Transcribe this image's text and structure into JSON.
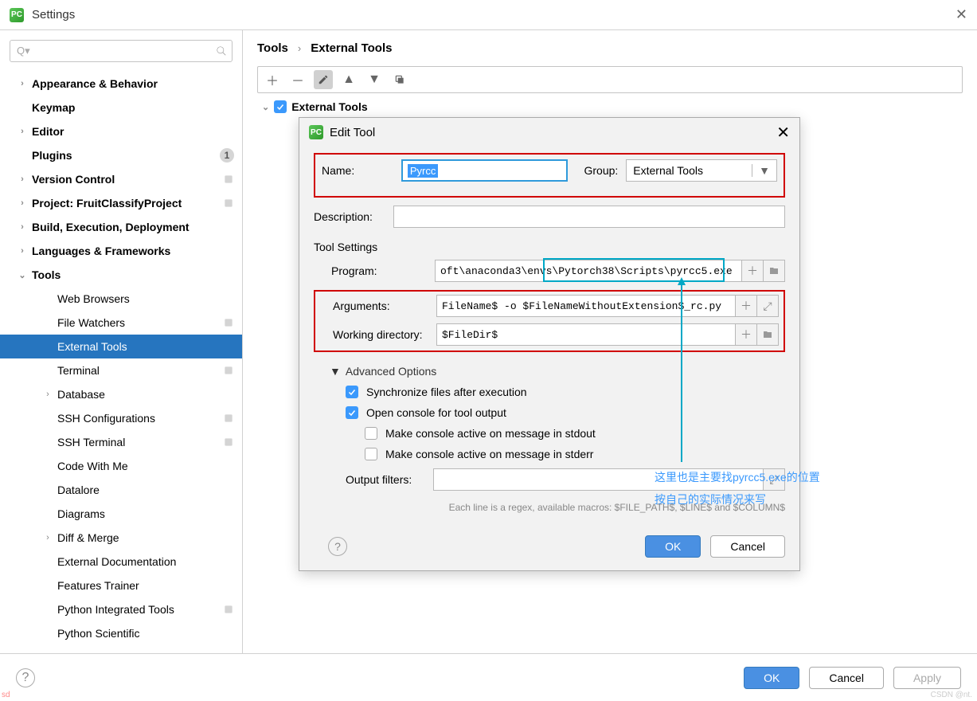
{
  "window": {
    "title": "Settings"
  },
  "search": {
    "placeholder": ""
  },
  "sidebar": [
    {
      "label": "Appearance & Behavior",
      "level": 1,
      "bold": true,
      "chev": "›"
    },
    {
      "label": "Keymap",
      "level": 1,
      "bold": true,
      "chev": ""
    },
    {
      "label": "Editor",
      "level": 1,
      "bold": true,
      "chev": "›"
    },
    {
      "label": "Plugins",
      "level": 1,
      "bold": true,
      "chev": "",
      "badge": "1"
    },
    {
      "label": "Version Control",
      "level": 1,
      "bold": true,
      "chev": "›",
      "mini": true
    },
    {
      "label": "Project: FruitClassifyProject",
      "level": 1,
      "bold": true,
      "chev": "›",
      "mini": true
    },
    {
      "label": "Build, Execution, Deployment",
      "level": 1,
      "bold": true,
      "chev": "›"
    },
    {
      "label": "Languages & Frameworks",
      "level": 1,
      "bold": true,
      "chev": "›"
    },
    {
      "label": "Tools",
      "level": 1,
      "bold": true,
      "chev": "⌄"
    },
    {
      "label": "Web Browsers",
      "level": 2
    },
    {
      "label": "File Watchers",
      "level": 2,
      "mini": true
    },
    {
      "label": "External Tools",
      "level": 2,
      "selected": true
    },
    {
      "label": "Terminal",
      "level": 2,
      "mini": true
    },
    {
      "label": "Database",
      "level": 2,
      "chev": "›"
    },
    {
      "label": "SSH Configurations",
      "level": 2,
      "mini": true
    },
    {
      "label": "SSH Terminal",
      "level": 2,
      "mini": true
    },
    {
      "label": "Code With Me",
      "level": 2
    },
    {
      "label": "Datalore",
      "level": 2
    },
    {
      "label": "Diagrams",
      "level": 2
    },
    {
      "label": "Diff & Merge",
      "level": 2,
      "chev": "›"
    },
    {
      "label": "External Documentation",
      "level": 2
    },
    {
      "label": "Features Trainer",
      "level": 2
    },
    {
      "label": "Python Integrated Tools",
      "level": 2,
      "mini": true
    },
    {
      "label": "Python Scientific",
      "level": 2
    }
  ],
  "breadcrumb": {
    "a": "Tools",
    "sep": "›",
    "b": "External Tools"
  },
  "content": {
    "group_label": "External Tools"
  },
  "dialog": {
    "title": "Edit Tool",
    "name_label": "Name:",
    "name_value": "Pyrcc",
    "group_label": "Group:",
    "group_value": "External Tools",
    "desc_label": "Description:",
    "desc_value": "",
    "tool_settings_h": "Tool Settings",
    "program_label": "Program:",
    "program_value": "oft\\anaconda3\\envs\\Pytorch38\\Scripts\\pyrcc5.exe",
    "arguments_label": "Arguments:",
    "arguments_value": "FileName$ -o $FileNameWithoutExtension$_rc.py",
    "wd_label": "Working directory:",
    "wd_value": "$FileDir$",
    "adv_h": "Advanced Options",
    "sync_label": "Synchronize files after execution",
    "console_label": "Open console for tool output",
    "stdout_label": "Make console active on message in stdout",
    "stderr_label": "Make console active on message in stderr",
    "filters_label": "Output filters:",
    "filters_value": "",
    "macro_note": "Each line is a regex, available macros: $FILE_PATH$, $LINE$ and $COLUMN$",
    "ok": "OK",
    "cancel": "Cancel"
  },
  "bottom": {
    "ok": "OK",
    "cancel": "Cancel",
    "apply": "Apply"
  },
  "annot": {
    "l1": "这里也是主要找pyrcc5.exe的位置",
    "l2": "按自己的实际情况来写"
  },
  "watermark": "CSDN @nt.",
  "sd": "sd"
}
